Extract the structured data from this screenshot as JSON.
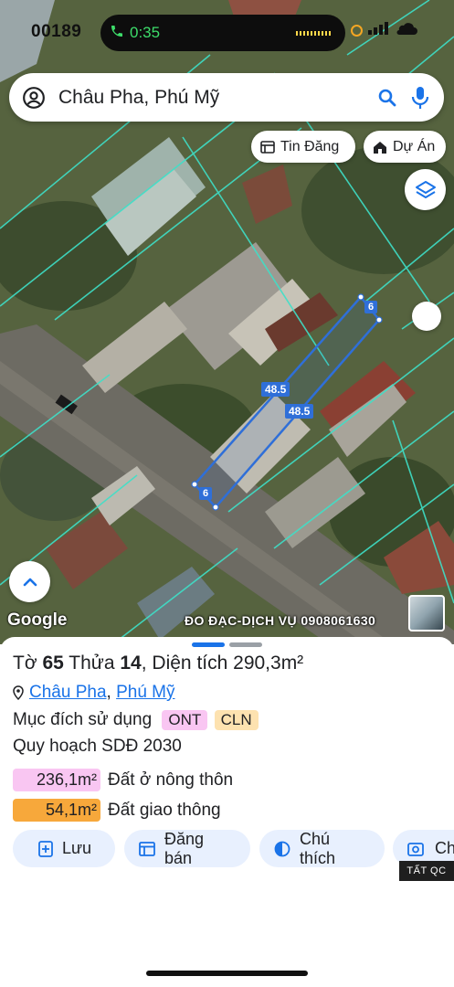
{
  "status": {
    "left_text": "00189",
    "time": "0:35"
  },
  "search": {
    "value": "Châu Pha, Phú Mỹ"
  },
  "map_chips": {
    "listing": "Tin Đăng",
    "project": "Dự Án"
  },
  "parcel_labels": {
    "short_top": "6",
    "short_bottom": "6",
    "long_a": "48.5",
    "long_b": "48.5"
  },
  "map_footer": {
    "logo": "Google",
    "survey": "ĐO ĐẠC-DỊCH VỤ 0908061630"
  },
  "parcel": {
    "sheet_label": "Tờ",
    "sheet_no": "65",
    "plot_label": "Thửa",
    "plot_no": "14",
    "area_label": "Diện tích",
    "area_value": "290,3m²",
    "commune": "Châu Pha",
    "separator": ",",
    "city": "Phú Mỹ",
    "purpose_label": "Mục đích sử dụng",
    "purpose_tags": [
      "ONT",
      "CLN"
    ],
    "plan_label": "Quy hoạch SDĐ 2030",
    "areas": [
      {
        "value": "236,1m²",
        "label": "Đất ở nông thôn",
        "color": "#f9c6f2"
      },
      {
        "value": "54,1m²",
        "label": "Đất giao thông",
        "color": "#f7a83b"
      }
    ]
  },
  "actions": {
    "save": "Lưu",
    "post": "Đăng bán",
    "legend": "Chú thích",
    "capture": "Ch"
  },
  "ad_label": "TẤT QC",
  "colors": {
    "accent": "#1a73e8",
    "action_bg": "#e8f0fe",
    "boundary": "#3ee0c8",
    "parcel_line": "#2f6fd8"
  }
}
